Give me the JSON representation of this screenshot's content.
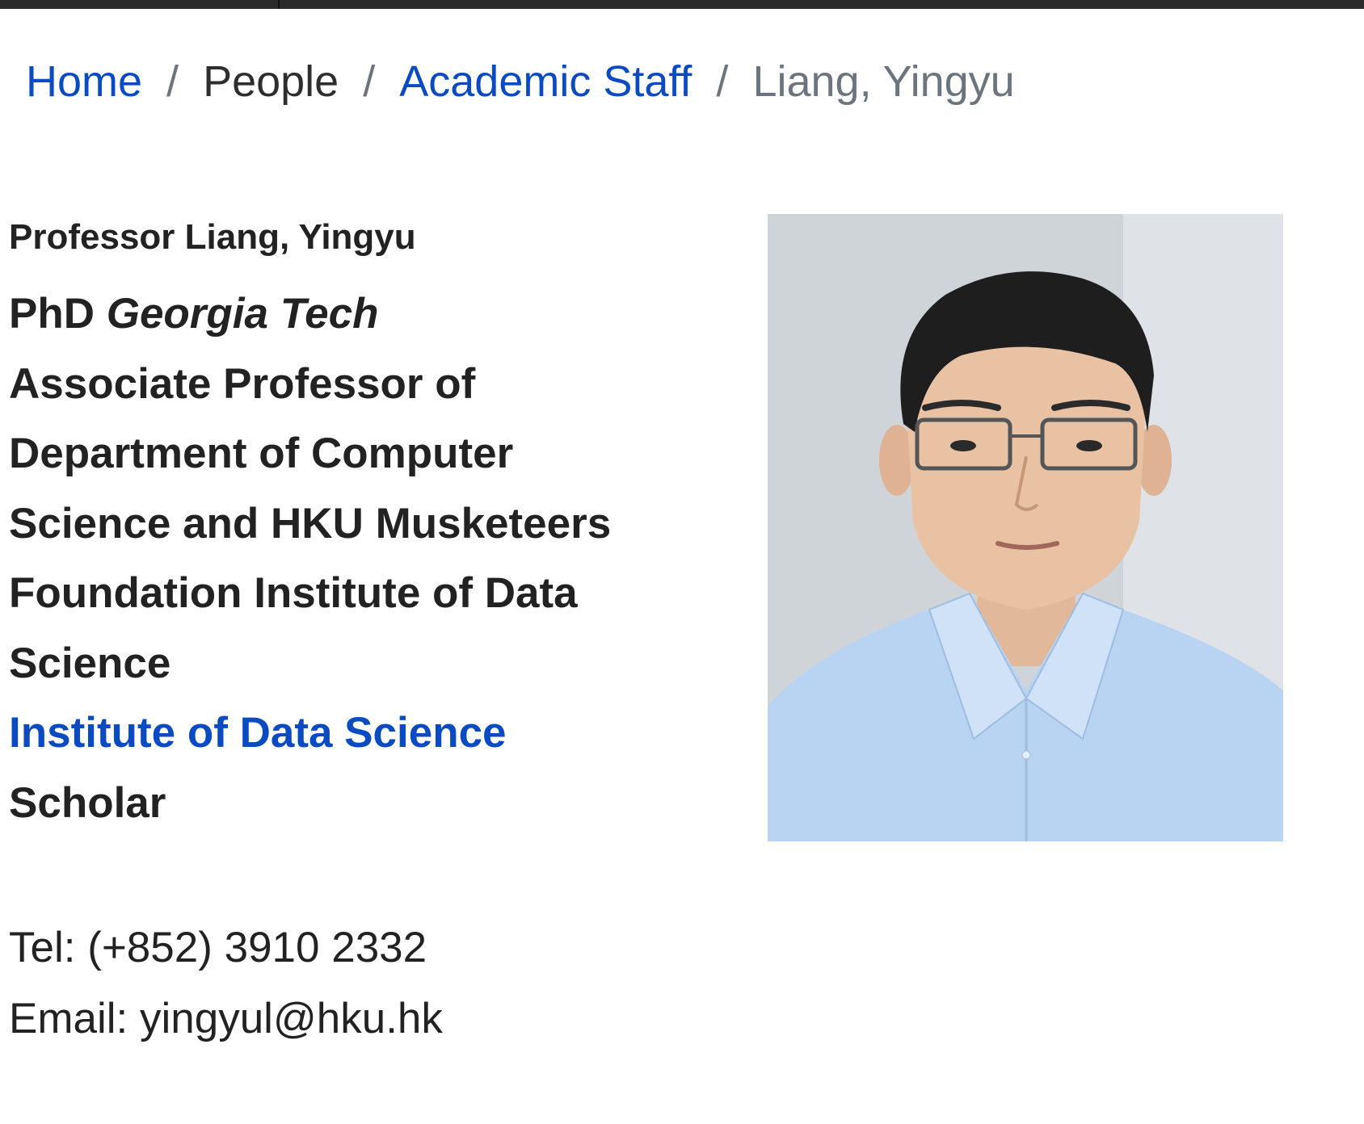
{
  "breadcrumb": {
    "home": "Home",
    "people": "People",
    "academic_staff": "Academic Staff",
    "current": "Liang, Yingyu",
    "separator": "/"
  },
  "profile": {
    "name": "Professor Liang, Yingyu",
    "degree": "PhD",
    "institution": "Georgia Tech",
    "title_lines": [
      "Associate Professor of",
      "Department of Computer",
      "Science and HKU Musketeers",
      "Foundation Institute of Data",
      "Science"
    ],
    "link_label": "Institute of Data Science",
    "link_suffix": "Scholar"
  },
  "contact": {
    "tel": "Tel: (+852) 3910 2332",
    "email": "Email: yingyul@hku.hk"
  },
  "colors": {
    "link": "#0a4bc2",
    "text": "#222222",
    "muted": "#6c757d",
    "topbar": "#2b2b2b"
  }
}
